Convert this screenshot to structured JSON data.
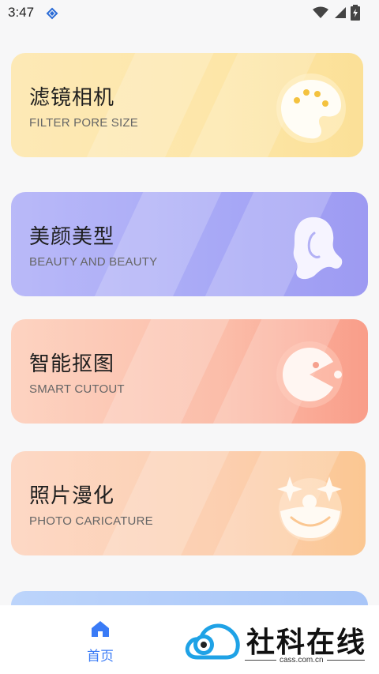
{
  "status_bar": {
    "time": "3:47",
    "icons": [
      "signal-notification-icon",
      "wifi-icon",
      "cell-signal-icon",
      "battery-charging-icon"
    ]
  },
  "cards": [
    {
      "id": "filter",
      "title": "滤镜相机",
      "subtitle": "FILTER PORE SIZE",
      "icon": "palette-icon"
    },
    {
      "id": "beauty",
      "title": "美颜美型",
      "subtitle": "BEAUTY AND BEAUTY",
      "icon": "woman-head-icon"
    },
    {
      "id": "cutout",
      "title": "智能抠图",
      "subtitle": "SMART CUTOUT",
      "icon": "pacman-icon"
    },
    {
      "id": "caricature",
      "title": "照片漫化",
      "subtitle": "PHOTO CARICATURE",
      "icon": "clown-face-icon"
    }
  ],
  "bottom_nav": {
    "home_label": "首页",
    "home_icon": "home-icon",
    "accent": "#3a7bf6"
  },
  "watermark": {
    "text": "社科在线",
    "sub": "cass.com.cn"
  }
}
